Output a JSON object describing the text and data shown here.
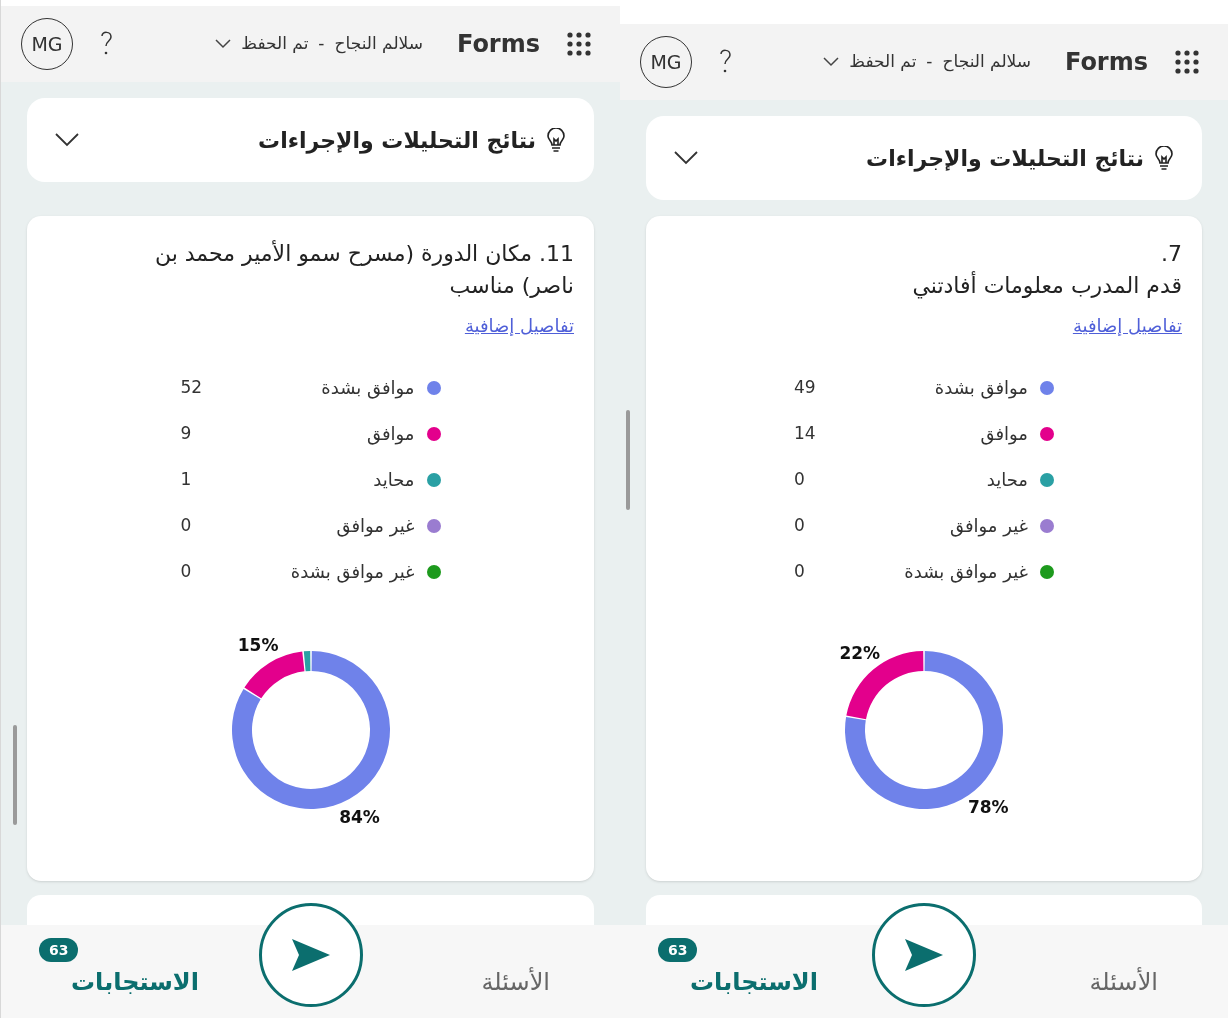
{
  "panels": [
    {
      "header": {
        "app_name": "Forms",
        "form_title": "سلالم النجاح",
        "separator": "-",
        "save_status": "تم الحفظ",
        "avatar": "MG"
      },
      "insights": {
        "title": "نتائج التحليلات والإجراءات",
        "expanded": false
      },
      "question": {
        "lines": [
          "7.",
          "قدم المدرب معلومات أفادتني"
        ],
        "link": "تفاصيل إضافية",
        "legend": [
          {
            "count": "49",
            "color": "#6f82ea"
          },
          {
            "count": "14",
            "color": "#e3008c"
          },
          {
            "count": "0",
            "color": "#2aa0a4"
          },
          {
            "count": "0",
            "color": "#9a7cd0"
          },
          {
            "count": "0",
            "color": "#1d9a1d"
          }
        ],
        "chart_data": {
          "type": "donut",
          "categories": [
            "موافق بشدة",
            "موافق",
            "محايد",
            "غير موافق",
            "غير موافق بشدة"
          ],
          "values": [
            77.78,
            22.22,
            0,
            0,
            0
          ],
          "value_labels": [
            "78%",
            "22%",
            null,
            null,
            null
          ]
        }
      },
      "bottom_nav": {
        "tabs": [
          {
            "label": "الأسئلة",
            "selected": false
          },
          {
            "label": "الاستجابات",
            "selected": true,
            "badge": "63"
          }
        ]
      }
    },
    {
      "header": {
        "app_name": "Forms",
        "form_title": "سلالم النجاح",
        "separator": "-",
        "save_status": "تم الحفظ",
        "avatar": "MG"
      },
      "insights": {
        "title": "نتائج التحليلات والإجراءات",
        "expanded": false
      },
      "question": {
        "lines": [
          "11. مكان الدورة (مسرح سمو الأمير محمد بن ناصر) مناسب"
        ],
        "link": "تفاصيل إضافية",
        "legend": [
          {
            "count": "52",
            "color": "#6f82ea"
          },
          {
            "count": "9",
            "color": "#e3008c"
          },
          {
            "count": "1",
            "color": "#2aa0a4"
          },
          {
            "count": "0",
            "color": "#9a7cd0"
          },
          {
            "count": "0",
            "color": "#1d9a1d"
          }
        ],
        "chart_data": {
          "type": "donut",
          "categories": [
            "موافق بشدة",
            "موافق",
            "محايد",
            "غير موافق",
            "غير موافق بشدة"
          ],
          "values": [
            83.87,
            14.52,
            1.61,
            0,
            0
          ],
          "value_labels": [
            "84%",
            "15%",
            null,
            null,
            null
          ]
        }
      },
      "bottom_nav": {
        "tabs": [
          {
            "label": "الأسئلة",
            "selected": false
          },
          {
            "label": "الاستجابات",
            "selected": true,
            "badge": "63"
          }
        ]
      }
    }
  ]
}
